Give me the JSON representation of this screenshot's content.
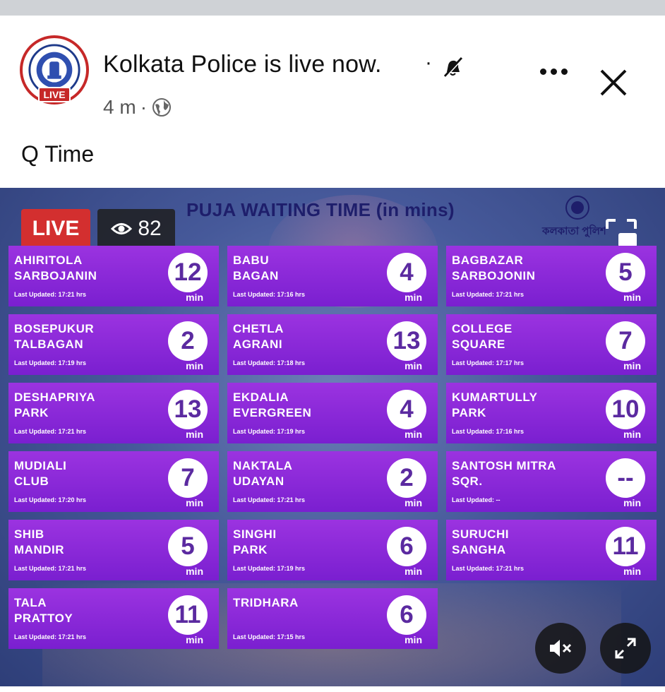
{
  "post": {
    "page_name": "Kolkata Police is live now.",
    "separator": "·",
    "time": "4 m",
    "meta_dot": "·",
    "avatar_live": "LIVE",
    "text": "Q Time"
  },
  "video": {
    "live_label": "LIVE",
    "viewer_count": "82",
    "board_title": "PUJA WAITING TIME (in mins)",
    "emblem_text": "কলকাতা পুলিশ",
    "tiles": [
      {
        "name_line1": "AHIRITOLA",
        "name_line2": "SARBOJANIN",
        "updated": "Last Updated: 17:21 hrs",
        "wait": "12",
        "unit": "min"
      },
      {
        "name_line1": "BABU",
        "name_line2": "BAGAN",
        "updated": "Last Updated: 17:16 hrs",
        "wait": "4",
        "unit": "min"
      },
      {
        "name_line1": "BAGBAZAR",
        "name_line2": "SARBOJONIN",
        "updated": "Last Updated: 17:21 hrs",
        "wait": "5",
        "unit": "min"
      },
      {
        "name_line1": "BOSEPUKUR",
        "name_line2": "TALBAGAN",
        "updated": "Last Updated: 17:19 hrs",
        "wait": "2",
        "unit": "min"
      },
      {
        "name_line1": "CHETLA",
        "name_line2": "AGRANI",
        "updated": "Last Updated: 17:18 hrs",
        "wait": "13",
        "unit": "min"
      },
      {
        "name_line1": "COLLEGE",
        "name_line2": "SQUARE",
        "updated": "Last Updated: 17:17 hrs",
        "wait": "7",
        "unit": "min"
      },
      {
        "name_line1": "DESHAPRIYA",
        "name_line2": "PARK",
        "updated": "Last Updated: 17:21 hrs",
        "wait": "13",
        "unit": "min"
      },
      {
        "name_line1": "EKDALIA",
        "name_line2": "EVERGREEN",
        "updated": "Last Updated: 17:19 hrs",
        "wait": "4",
        "unit": "min"
      },
      {
        "name_line1": "KUMARTULLY",
        "name_line2": "PARK",
        "updated": "Last Updated: 17:16 hrs",
        "wait": "10",
        "unit": "min"
      },
      {
        "name_line1": "MUDIALI",
        "name_line2": "CLUB",
        "updated": "Last Updated: 17:20 hrs",
        "wait": "7",
        "unit": "min"
      },
      {
        "name_line1": "NAKTALA",
        "name_line2": "UDAYAN",
        "updated": "Last Updated: 17:21 hrs",
        "wait": "2",
        "unit": "min"
      },
      {
        "name_line1": "SANTOSH MITRA",
        "name_line2": "SQR.",
        "updated": "Last Updated: --",
        "wait": "--",
        "unit": "min"
      },
      {
        "name_line1": "SHIB",
        "name_line2": "MANDIR",
        "updated": "Last Updated: 17:21 hrs",
        "wait": "5",
        "unit": "min"
      },
      {
        "name_line1": "SINGHI",
        "name_line2": "PARK",
        "updated": "Last Updated: 17:19 hrs",
        "wait": "6",
        "unit": "min"
      },
      {
        "name_line1": "SURUCHI",
        "name_line2": "SANGHA",
        "updated": "Last Updated: 17:21 hrs",
        "wait": "11",
        "unit": "min"
      },
      {
        "name_line1": "TALA",
        "name_line2": "PRATTOY",
        "updated": "Last Updated: 17:21 hrs",
        "wait": "11",
        "unit": "min"
      },
      {
        "name_line1": "TRIDHARA",
        "name_line2": "",
        "updated": "Last Updated: 17:15 hrs",
        "wait": "6",
        "unit": "min"
      }
    ]
  },
  "icons": {
    "more": "more-horizontal-icon",
    "close": "close-icon",
    "mute": "muted-bell-icon",
    "globe": "globe-icon",
    "eye": "eye-icon",
    "pip": "picture-in-picture-icon",
    "sound": "speaker-muted-icon",
    "expand": "expand-icon"
  },
  "colors": {
    "tile": "#8a28d8",
    "live": "#d32f2f",
    "circle_text": "#5b2aa0"
  }
}
